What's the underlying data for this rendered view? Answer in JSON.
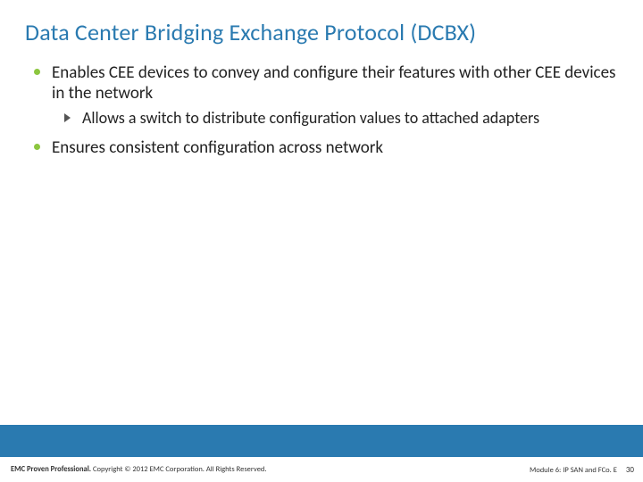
{
  "title": "Data Center Bridging Exchange Protocol (DCBX)",
  "bullets": {
    "b1a": "Enables CEE devices to convey and configure their features with other CEE devices in the network",
    "b2a": "Allows a switch to distribute configuration values to attached adapters",
    "b1b": "Ensures consistent configuration across network"
  },
  "footer": {
    "left_bold": "EMC Proven Professional.",
    "left_rest": " Copyright © 2012 EMC Corporation. All Rights Reserved.",
    "right_module": "Module 6: IP SAN and FCo. E",
    "page": "30"
  }
}
